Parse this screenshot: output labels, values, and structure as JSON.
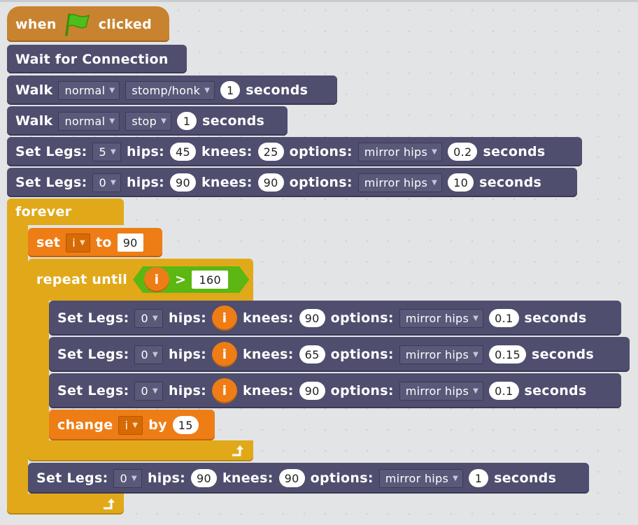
{
  "colors": {
    "robot": "#4f4e6e",
    "events": "#c88330",
    "control": "#e1a91a",
    "data": "#ee7d16",
    "operator": "#5cb712",
    "background": "#e2e4e6"
  },
  "hat": {
    "when": "when",
    "flag_icon": "green-flag-icon",
    "clicked": "clicked"
  },
  "wait": {
    "label": "Wait for Connection"
  },
  "walk1": {
    "label": "Walk",
    "gait": "normal",
    "mode": "stomp/honk",
    "duration": "1",
    "unit": "seconds"
  },
  "walk2": {
    "label": "Walk",
    "gait": "normal",
    "mode": "stop",
    "duration": "1",
    "unit": "seconds"
  },
  "legs1": {
    "label": "Set Legs:",
    "legs": "5",
    "hips_label": "hips:",
    "hips": "45",
    "knees_label": "knees:",
    "knees": "25",
    "options_label": "options:",
    "option": "mirror hips",
    "duration": "0.2",
    "unit": "seconds"
  },
  "legs2": {
    "label": "Set Legs:",
    "legs": "0",
    "hips_label": "hips:",
    "hips": "90",
    "knees_label": "knees:",
    "knees": "90",
    "options_label": "options:",
    "option": "mirror hips",
    "duration": "10",
    "unit": "seconds"
  },
  "forever": {
    "label": "forever",
    "loop_icon": "loop-arrow-icon"
  },
  "set_var": {
    "label": "set",
    "var": "i",
    "to": "to",
    "value": "90"
  },
  "repeat": {
    "label": "repeat until",
    "var": "i",
    "op": ">",
    "value": "160",
    "loop_icon": "loop-arrow-icon"
  },
  "inner1": {
    "label": "Set Legs:",
    "legs": "0",
    "hips_label": "hips:",
    "hips_var": "i",
    "knees_label": "knees:",
    "knees": "90",
    "options_label": "options:",
    "option": "mirror hips",
    "duration": "0.1",
    "unit": "seconds"
  },
  "inner2": {
    "label": "Set Legs:",
    "legs": "0",
    "hips_label": "hips:",
    "hips_var": "i",
    "knees_label": "knees:",
    "knees": "65",
    "options_label": "options:",
    "option": "mirror hips",
    "duration": "0.15",
    "unit": "seconds"
  },
  "inner3": {
    "label": "Set Legs:",
    "legs": "0",
    "hips_label": "hips:",
    "hips_var": "i",
    "knees_label": "knees:",
    "knees": "90",
    "options_label": "options:",
    "option": "mirror hips",
    "duration": "0.1",
    "unit": "seconds"
  },
  "change": {
    "label": "change",
    "var": "i",
    "by": "by",
    "value": "15"
  },
  "legs_after": {
    "label": "Set Legs:",
    "legs": "0",
    "hips_label": "hips:",
    "hips": "90",
    "knees_label": "knees:",
    "knees": "90",
    "options_label": "options:",
    "option": "mirror hips",
    "duration": "1",
    "unit": "seconds"
  }
}
